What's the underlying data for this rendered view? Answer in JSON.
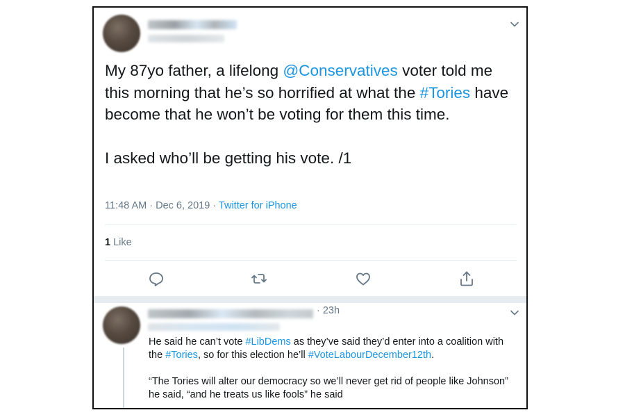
{
  "tweet": {
    "text": {
      "p1_a": "My 87yo father, a lifelong ",
      "p1_mention": "@Conservatives",
      "p1_b": " voter told me this morning that he’s so horrified at what the ",
      "p1_hashtag": "#Tories",
      "p1_c": " have become that he won’t be voting for them this time.",
      "p2": "I asked who’ll be getting his vote. /1"
    },
    "time": "11:48 AM",
    "sep": " · ",
    "date": "Dec 6, 2019",
    "source": "Twitter for iPhone",
    "likes_count": "1",
    "likes_label": " Like"
  },
  "reply": {
    "time": "· 23h",
    "p1_a": "He said he can’t vote ",
    "p1_hashtag1": "#LibDems",
    "p1_b": " as they’ve said they’d enter into a coalition with the ",
    "p1_hashtag2": "#Tories",
    "p1_c": ", so for this election he’ll ",
    "p1_hashtag3": "#VoteLabourDecember12th",
    "p1_d": ".",
    "p2": "“The Tories will alter our democracy so we’ll never get rid of people like Johnson” he said, “and he treats us like fools” he said"
  },
  "icons": {
    "caret": "chevron-down-icon",
    "reply": "reply-icon",
    "retweet": "retweet-icon",
    "like": "heart-icon",
    "share": "share-icon"
  },
  "colors": {
    "link": "#1b95e0",
    "text": "#14171a",
    "muted": "#657786",
    "divider": "#e6ecf0"
  }
}
